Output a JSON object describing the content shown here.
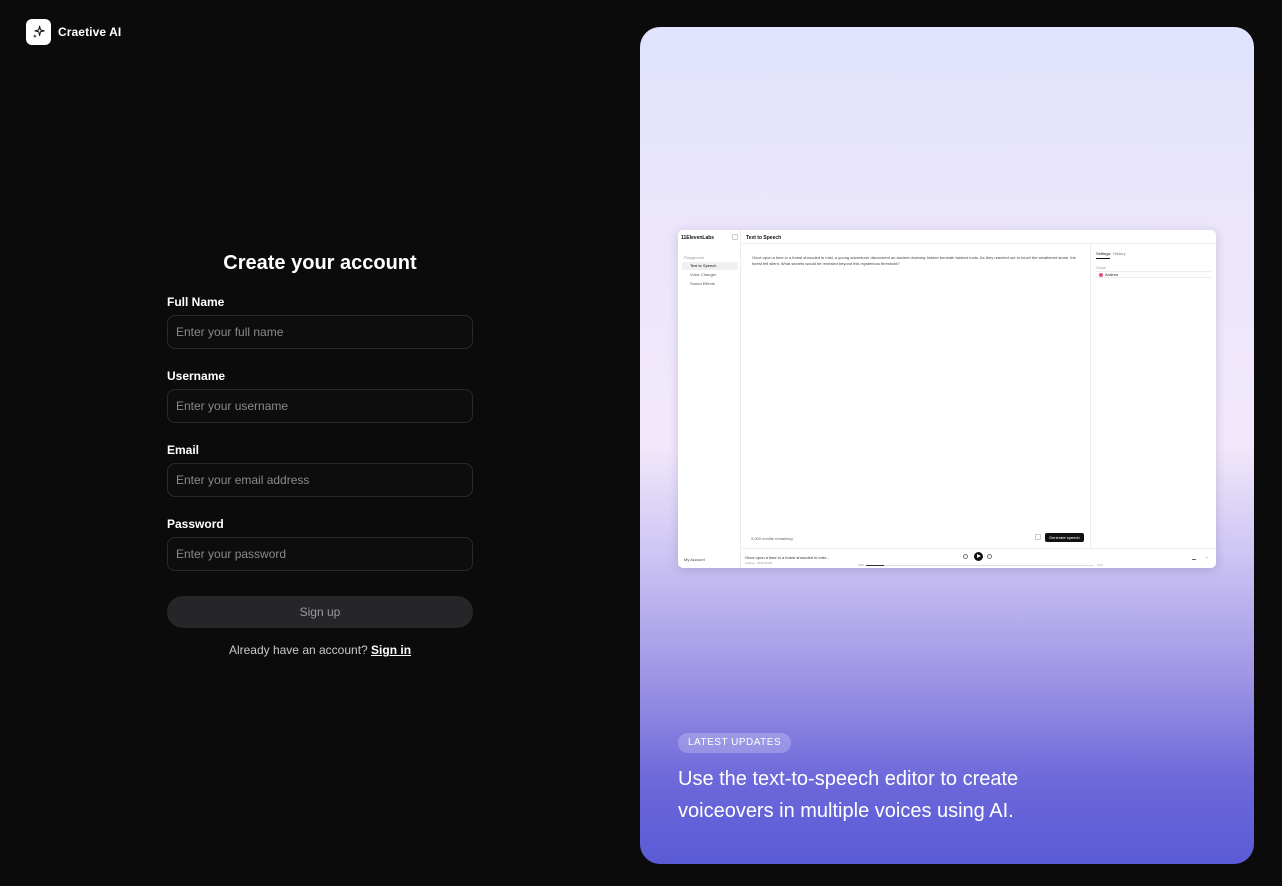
{
  "brand": {
    "name": "Craetive AI",
    "icon": "sparkle-icon"
  },
  "form": {
    "title": "Create your account",
    "fields": [
      {
        "label": "Full Name",
        "placeholder": "Enter your full name",
        "value": ""
      },
      {
        "label": "Username",
        "placeholder": "Enter your username",
        "value": ""
      },
      {
        "label": "Email",
        "placeholder": "Enter your email address",
        "value": ""
      },
      {
        "label": "Password",
        "placeholder": "Enter your password",
        "value": ""
      }
    ],
    "submit_label": "Sign up",
    "signin_prompt": "Already have an account?",
    "signin_link": "Sign in"
  },
  "panel": {
    "badge": "LATEST UPDATES",
    "headline_line1": "Use the text-to-speech editor to create",
    "headline_line2": "voiceovers in multiple voices using AI.",
    "preview": {
      "logo": "11ElevenLabs",
      "page_title": "Text to Speech",
      "sidebar_category": "Playground",
      "nav": [
        "Text to Speech",
        "Voice Changer",
        "Sound Effects"
      ],
      "account": "My Account",
      "body_text": "Once upon a time in a forest shrouded in mist, a young adventurer discovered an ancient doorway hidden beneath twisted roots. As they reached out to touch the weathered stone, the forest fell silent. What secrets would be revealed beyond this mysterious threshold?",
      "tabs": [
        "Settings",
        "History"
      ],
      "voice_label": "Voice",
      "voice_name": "Andrea",
      "credits_text": "9,000 credits remaining",
      "generate_label": "Generate speech",
      "player_snippet": "Once upon a time in a forest shrouded in mist...",
      "player_sub": "Andrea · 01/01/2025",
      "time_start": "0:00",
      "time_end": "0:13",
      "accent": "#5a5bd6"
    }
  }
}
